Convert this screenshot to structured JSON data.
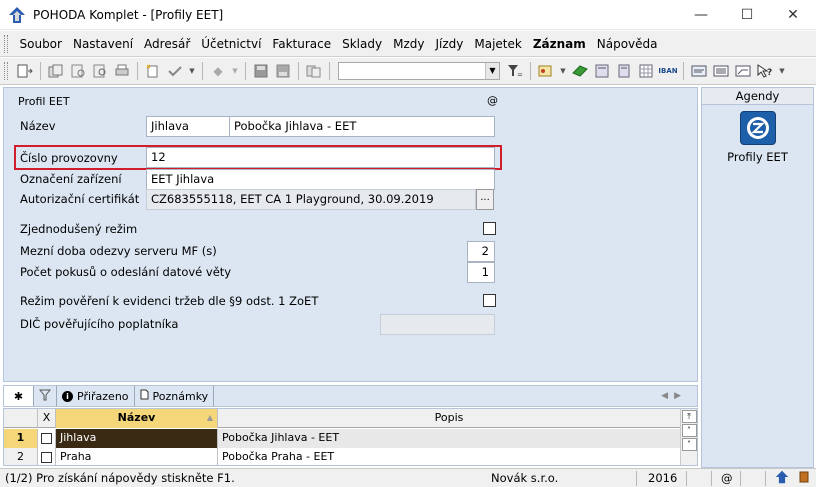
{
  "window": {
    "title": "POHODA Komplet - [Profily EET]",
    "controls": [
      "—",
      "☐",
      "✕"
    ]
  },
  "menu": [
    "Soubor",
    "Nastavení",
    "Adresář",
    "Účetnictví",
    "Fakturace",
    "Sklady",
    "Mzdy",
    "Jízdy",
    "Majetek",
    "Záznam",
    "Nápověda"
  ],
  "toolbar": {
    "combo_value": ""
  },
  "form": {
    "section_title": "Profil EET",
    "at_symbol": "@",
    "nazev_label": "Název",
    "nazev_value": "Jihlava",
    "nazev_desc": "Pobočka Jihlava - EET",
    "provozovna_label": "Číslo provozovny",
    "provozovna_value": "12",
    "zarizeni_label": "Označení zařízení",
    "zarizeni_value": "EET Jihlava",
    "certifikat_label": "Autorizační certifikát",
    "certifikat_value": "CZ683555118, EET CA 1 Playground, 30.09.2019",
    "browse_label": "...",
    "zjednoduseny_label": "Zjednodušený režim",
    "mezni_label": "Mezní doba odezvy serveru MF (s)",
    "mezni_value": "2",
    "pokusy_label": "Počet pokusů o odeslání datové věty",
    "pokusy_value": "1",
    "povereni_label": "Režim pověření k evidenci tržeb dle §9 odst. 1 ZoET",
    "dic_label": "DIČ pověřujícího poplatníka",
    "dic_value": ""
  },
  "agenda": {
    "header": "Agendy",
    "item_label": "Profily EET"
  },
  "tabs": {
    "first": "✱",
    "assigned": "Přiřazeno",
    "notes": "Poznámky"
  },
  "grid": {
    "col_x": "X",
    "col_nazev": "Název",
    "col_popis": "Popis",
    "rows": [
      {
        "num": "1",
        "nazev": "Jihlava",
        "popis": "Pobočka Jihlava - EET"
      },
      {
        "num": "2",
        "nazev": "Praha",
        "popis": "Pobočka Praha - EET"
      }
    ]
  },
  "status": {
    "help": "(1/2) Pro získání nápovědy stiskněte F1.",
    "company": "Novák s.r.o.",
    "year": "2016",
    "at": "@"
  },
  "colors": {
    "form_bg": "#dce6f2",
    "highlight_red": "#d11e2a",
    "selected_row": "#3a2a14",
    "accent_blue": "#1d5fa8"
  }
}
